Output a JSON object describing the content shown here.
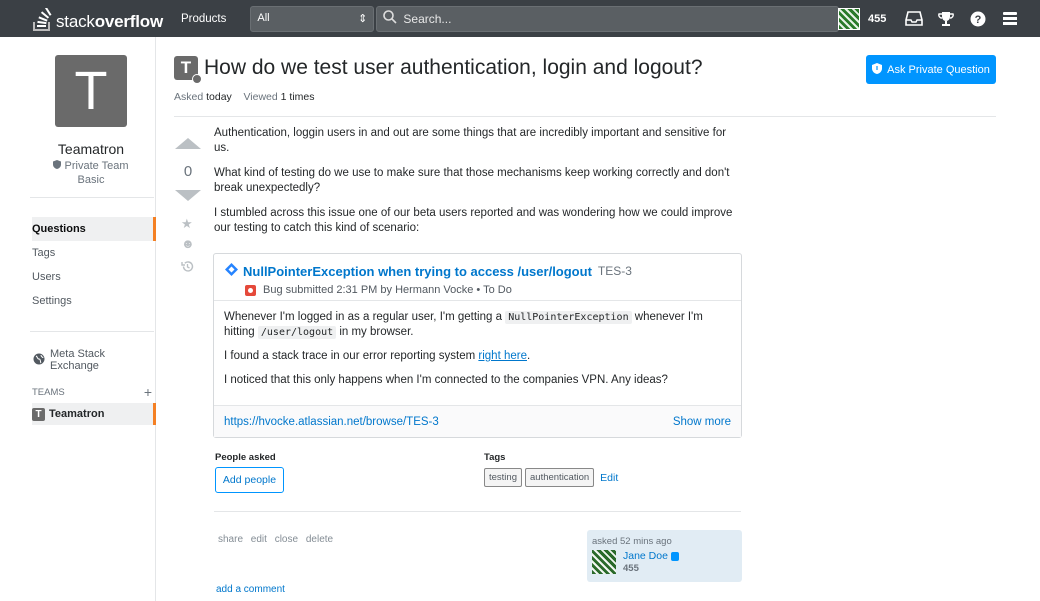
{
  "topbar": {
    "logo_light": "stack",
    "logo_bold": "overflow",
    "products": "Products",
    "search_scope": "All",
    "search_placeholder": "Search...",
    "reputation": "455"
  },
  "sidebar": {
    "team_avatar_letter": "T",
    "team_name": "Teamatron",
    "team_type": "Private Team",
    "team_plan": "Basic",
    "nav": [
      {
        "label": "Questions",
        "active": true
      },
      {
        "label": "Tags"
      },
      {
        "label": "Users"
      },
      {
        "label": "Settings"
      }
    ],
    "meta_link": "Meta Stack Exchange",
    "teams_label": "TEAMS",
    "teams_add": "+",
    "team_item_letter": "T",
    "team_item": "Teamatron"
  },
  "question": {
    "icon_letter": "T",
    "title": "How do we test user authentication, login and logout?",
    "asked_label": "Asked",
    "asked_value": "today",
    "viewed_label": "Viewed",
    "viewed_value": "1 times",
    "ask_button": "Ask Private Question",
    "votes": "0",
    "paragraphs": [
      "Authentication, loggin users in and out are some things that are incredibly important and sensitive for us.",
      "What kind of testing do we use to make sure that those mechanisms keep working correctly and don't break unexpectedly?",
      "I stumbled across this issue one of our beta users reported and was wondering how we could improve our testing to catch this kind of scenario:"
    ]
  },
  "jira": {
    "title": "NullPointerException when trying to access /user/logout",
    "key": "TES-3",
    "subtitle": "Bug submitted 2:31 PM by Hermann Vocke • To Do",
    "p1_a": "Whenever I'm logged in as a regular user, I'm getting a ",
    "p1_code1": "NullPointerException",
    "p1_b": " whenever I'm hitting ",
    "p1_code2": "/user/logout",
    "p1_c": " in my browser.",
    "p2_a": "I found a stack trace in our error reporting system ",
    "p2_link": "right here",
    "p2_b": ".",
    "p3": "I noticed that this only happens when I'm connected to the companies VPN. Any ideas?",
    "url": "https://hvocke.atlassian.net/browse/TES-3",
    "show_more": "Show more"
  },
  "people": {
    "label": "People asked",
    "button": "Add people"
  },
  "tags": {
    "label": "Tags",
    "items": [
      "testing",
      "authentication"
    ],
    "edit": "Edit"
  },
  "post_menu": {
    "share": "share",
    "edit": "edit",
    "close": "close",
    "delete": "delete"
  },
  "owner": {
    "asked_time": "asked 52 mins ago",
    "name": "Jane Doe",
    "reputation": "455"
  },
  "add_comment": "add a comment"
}
